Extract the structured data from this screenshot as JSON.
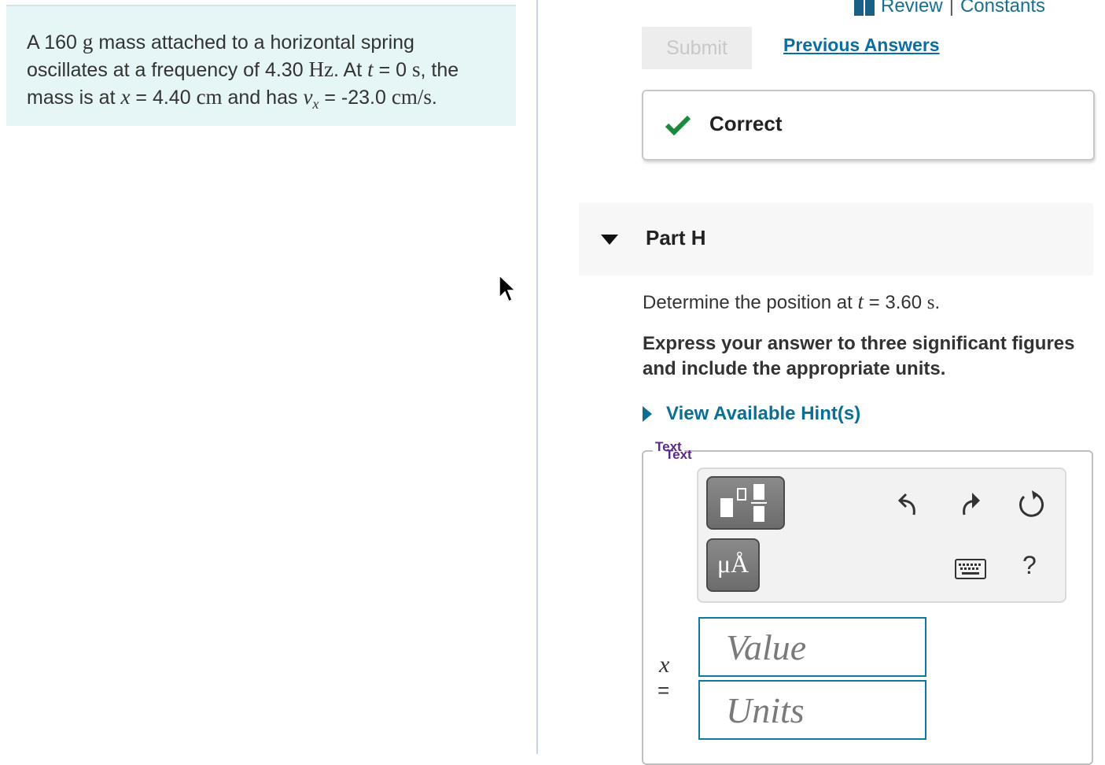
{
  "problem": {
    "p1": "A 160 ",
    "mass_unit": "g",
    "p2": " mass attached to a horizontal spring oscillates at a frequency of 4.30 ",
    "freq_unit": "Hz",
    "p3": ". At ",
    "t_var": "t",
    "p4": " = 0 ",
    "s_unit1": "s",
    "p5": ", the mass is at ",
    "x_var": "x",
    "p6": " = 4.40 ",
    "cm_unit": "cm",
    "p7": " and has ",
    "v_var": "v",
    "v_sub": "x",
    "p8": " = -23.0 ",
    "vel_unit": "cm/s",
    "p9": "."
  },
  "header": {
    "review_label": "Review",
    "separator": "|",
    "constants_label": "Constants"
  },
  "submit": {
    "label": "Submit",
    "previous_answers": "Previous Answers"
  },
  "feedback": {
    "status": "Correct",
    "status_color": "#1b8a3e"
  },
  "part": {
    "title": "Part H",
    "question_prefix": "Determine the position at ",
    "question_var": "t",
    "question_mid": " = 3.60 ",
    "question_unit": "s",
    "question_suffix": ".",
    "instructions": "Express your answer to three significant figures and include the appropriate units.",
    "hints_label": "View Available Hint(s)"
  },
  "answer": {
    "mode_tab": "Text",
    "units_button_label": "μÅ",
    "help_label": "?",
    "variable": "x",
    "equals": "=",
    "value_placeholder": "Value",
    "units_placeholder": "Units"
  },
  "icons": {
    "book": "book-icon",
    "check": "checkmark-icon",
    "caret": "caret-down-icon",
    "hint_arrow": "caret-right-icon",
    "templates": "templates-icon",
    "undo": "undo-icon",
    "redo": "redo-icon",
    "reset": "reset-icon",
    "keyboard": "keyboard-icon",
    "cursor": "mouse-pointer-icon"
  },
  "colors": {
    "accent_link": "#0a6ea2",
    "problem_bg": "#e6f5f5",
    "field_border": "#0e7aa0"
  }
}
